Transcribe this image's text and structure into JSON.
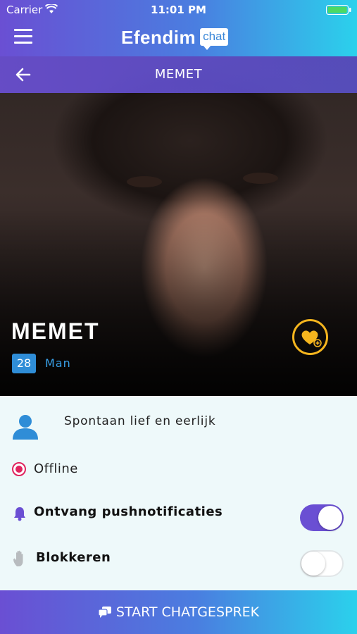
{
  "status_bar": {
    "carrier": "Carrier",
    "time": "11:01 PM"
  },
  "header": {
    "brand": "Efendim",
    "brand_badge": "chat"
  },
  "nav": {
    "title": "MEMET"
  },
  "profile": {
    "name": "MEMET",
    "age": "28",
    "gender": "Man",
    "bio": "Spontaan lief en eerlijk",
    "status": "Offline"
  },
  "settings": {
    "push_label": "Ontvang pushnotificaties",
    "push_enabled": true,
    "block_label": "Blokkeren",
    "block_enabled": false
  },
  "cta": {
    "label": "START CHATGESPREK"
  },
  "colors": {
    "accent_purple": "#6a4fd3",
    "accent_cyan": "#2bd1ec",
    "badge_blue": "#2f8dd7",
    "favorite_gold": "#f5b51e",
    "status_red": "#e0245e"
  },
  "icons": [
    "wifi-icon",
    "battery-icon",
    "hamburger-icon",
    "back-arrow-icon",
    "heart-plus-icon",
    "user-icon",
    "bell-icon",
    "hand-icon",
    "chat-bubbles-icon"
  ]
}
